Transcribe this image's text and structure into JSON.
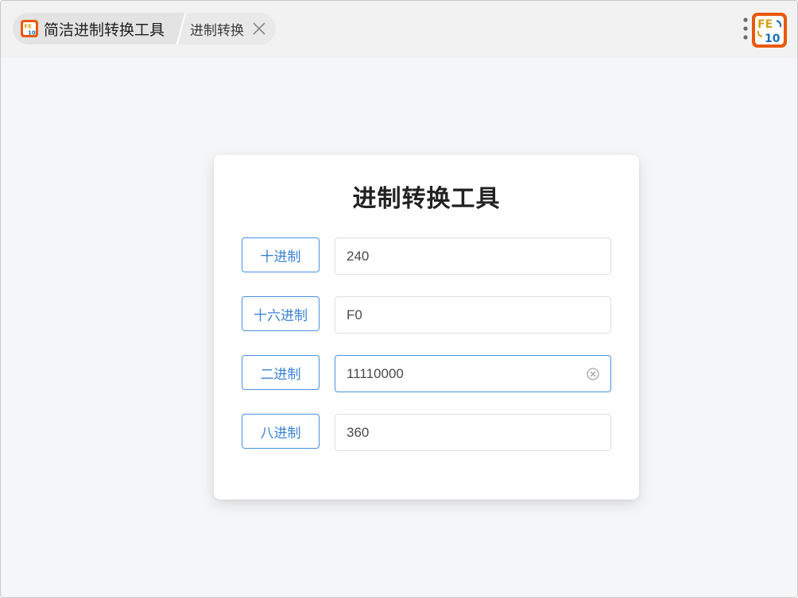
{
  "tabs": {
    "main_label": "简洁进制转换工具",
    "sub_label": "进制转换"
  },
  "icons": {
    "app": "fe-app-icon",
    "close": "close-icon",
    "menu": "more-vertical-icon",
    "brand": "fe-brand-icon",
    "clear": "clear-icon"
  },
  "colors": {
    "accent": "#4a90e2",
    "brand": "#e8590c"
  },
  "card": {
    "title": "进制转换工具",
    "rows": [
      {
        "label": "十进制",
        "value": "240"
      },
      {
        "label": "十六进制",
        "value": "F0"
      },
      {
        "label": "二进制",
        "value": "11110000"
      },
      {
        "label": "八进制",
        "value": "360"
      }
    ]
  }
}
